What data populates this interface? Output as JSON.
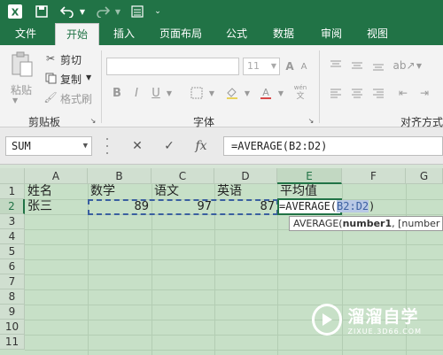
{
  "quick_access": {
    "excel_icon": "excel-logo-icon",
    "save_icon": "save-icon",
    "undo_icon": "undo-icon",
    "redo_icon": "redo-icon",
    "form_icon": "form-icon",
    "customize_icon": "customize-dropdown-icon"
  },
  "tabs": [
    "文件",
    "开始",
    "插入",
    "页面布局",
    "公式",
    "数据",
    "审阅",
    "视图"
  ],
  "active_tab": "开始",
  "ribbon": {
    "clipboard": {
      "paste": "粘贴",
      "cut": "剪切",
      "copy": "复制",
      "format_painter": "格式刷",
      "group": "剪贴板"
    },
    "font": {
      "size": "11",
      "group": "字体"
    },
    "alignment": {
      "group": "对齐方式"
    }
  },
  "formula_bar": {
    "name_box": "SUM",
    "cancel": "✕",
    "enter": "✓",
    "fx": "fx",
    "formula": "=AVERAGE(B2:D2)"
  },
  "columns": [
    "A",
    "B",
    "C",
    "D",
    "E",
    "F",
    "G"
  ],
  "selected_column": "E",
  "rows": [
    "1",
    "2",
    "3",
    "4",
    "5",
    "6",
    "7",
    "8",
    "9",
    "10",
    "11"
  ],
  "selected_row": "2",
  "cells": {
    "A1": "姓名",
    "B1": "数学",
    "C1": "语文",
    "D1": "英语",
    "E1": "平均值",
    "A2": "张三",
    "B2": "89",
    "C2": "97",
    "D2": "87",
    "E2_prefix": "=AVERAGE(",
    "E2_ref": "B2:D2",
    "E2_suffix": ")"
  },
  "tooltip": {
    "fn": "AVERAGE(",
    "arg": "number1",
    "rest": ", [number"
  },
  "watermark": {
    "title": "溜溜自学",
    "url": "ZIXUE.3D66.COM"
  },
  "colors": {
    "accent": "#217346",
    "grid_bg": "#c7e0c7",
    "ref_blue": "#3a5fa0"
  }
}
